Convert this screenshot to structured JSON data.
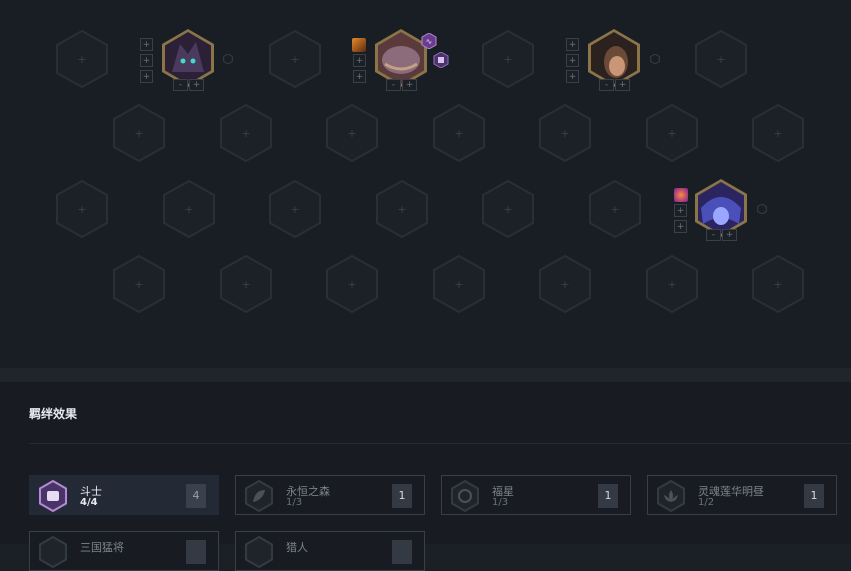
{
  "board": {
    "empty_slot_symbol": "+",
    "champions": [
      {
        "name": "kha-zix-champion",
        "portrait_colors": [
          "#2b2035",
          "#4a3b5e",
          "#45d9c7"
        ],
        "items": [],
        "add_symbol": "+",
        "remove_symbol": "-"
      },
      {
        "name": "tahm-kench-champion",
        "portrait_colors": [
          "#5a3a3a",
          "#8c6b7a",
          "#c5a088"
        ],
        "items": [
          "flame-item"
        ],
        "add_symbol": "+",
        "remove_symbol": "-"
      },
      {
        "name": "yone-champion",
        "portrait_colors": [
          "#2b2220",
          "#6b4a38",
          "#c99677"
        ],
        "items": [],
        "add_symbol": "+",
        "remove_symbol": "-"
      },
      {
        "name": "evelynn-champion",
        "portrait_colors": [
          "#2a2460",
          "#4a50b8",
          "#9aa6ff"
        ],
        "items": [
          "crystal-item"
        ],
        "add_symbol": "+",
        "remove_symbol": "-"
      }
    ]
  },
  "traits": {
    "title": "羁绊效果",
    "list": [
      {
        "name": "斗士",
        "count": "4/4",
        "level": "4",
        "active": true,
        "icon": "fist-icon",
        "color": "#b48ad6"
      },
      {
        "name": "永恒之森",
        "count": "1/3",
        "level": "1",
        "active": false,
        "icon": "leaf-icon"
      },
      {
        "name": "福星",
        "count": "1/3",
        "level": "1",
        "active": false,
        "icon": "coin-icon"
      },
      {
        "name": "灵魂莲华明昼",
        "count": "1/2",
        "level": "1",
        "active": false,
        "icon": "lotus-icon"
      },
      {
        "name": "三国猛将",
        "count": "",
        "level": "",
        "active": false,
        "icon": "helmet-icon"
      },
      {
        "name": "猎人",
        "count": "",
        "level": "",
        "active": false,
        "icon": "bow-icon"
      }
    ]
  }
}
